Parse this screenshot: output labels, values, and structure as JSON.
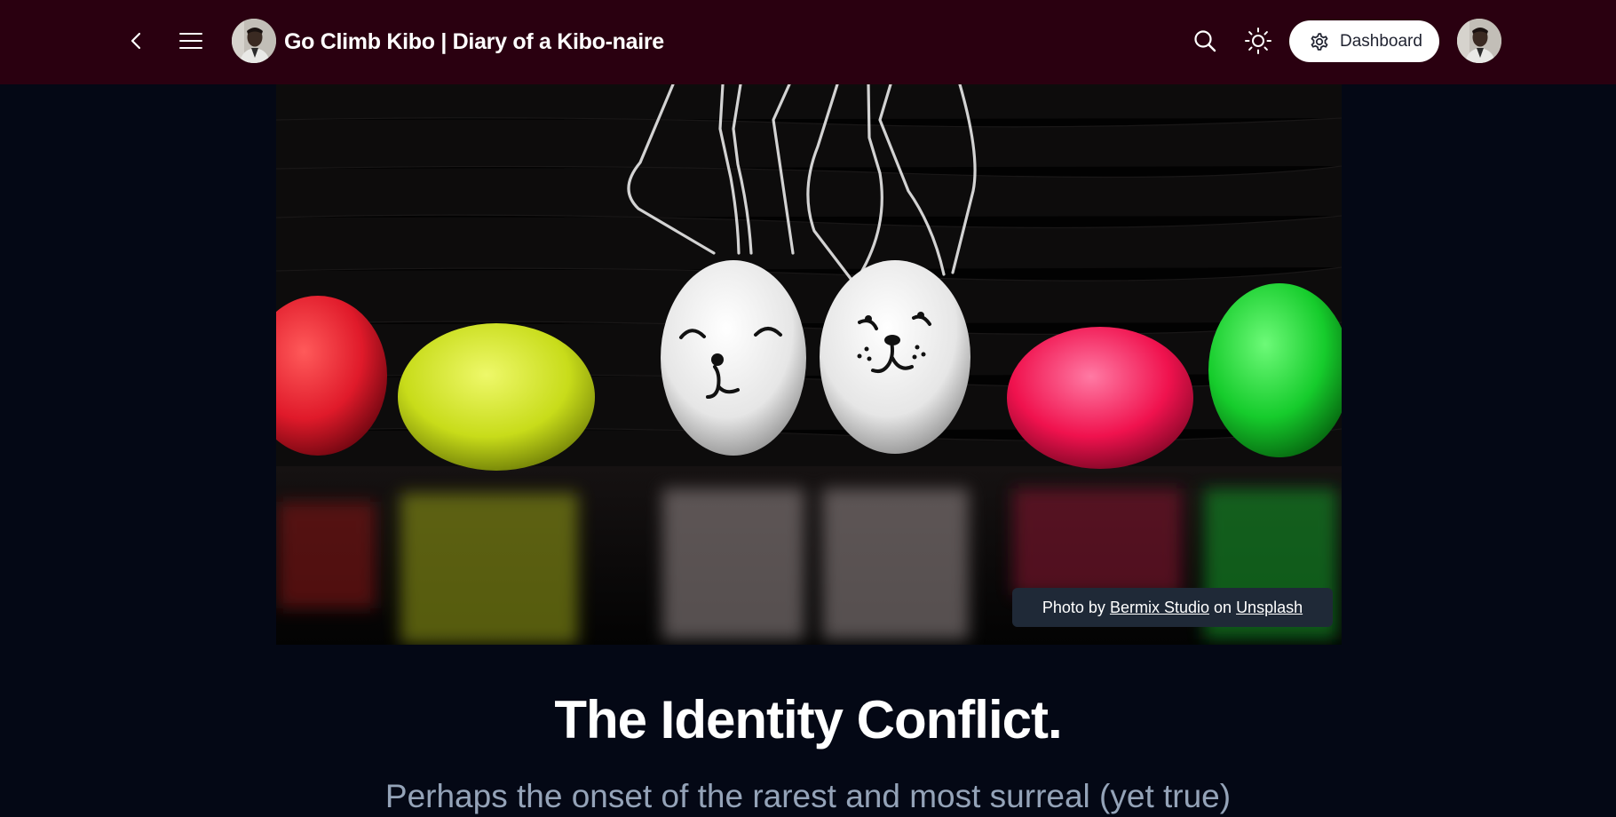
{
  "header": {
    "blog_title": "Go Climb Kibo | Diary of a Kibo-naire",
    "dashboard_label": "Dashboard",
    "icons": [
      "chevron-left-icon",
      "hamburger-menu-icon",
      "search-icon",
      "sun-icon",
      "gear-icon"
    ],
    "background_color": "#2a0010"
  },
  "cover": {
    "credit": {
      "prefix": "Photo by",
      "author": "Bermix Studio",
      "joiner": "on",
      "source": "Unsplash"
    }
  },
  "post": {
    "title": "The Identity Conflict.",
    "subtitle": "Perhaps the onset of the rarest and most surreal (yet true)"
  },
  "colors": {
    "page_background": "#040815",
    "subtitle_text": "#94a3b8",
    "credit_background": "#1f2937"
  }
}
